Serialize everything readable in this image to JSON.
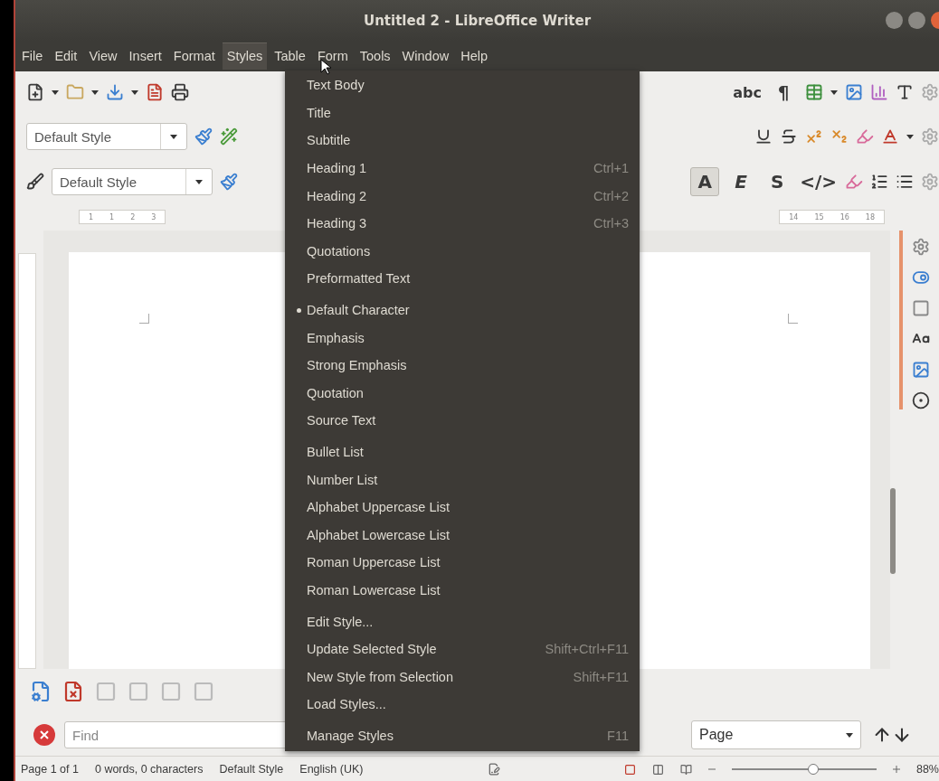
{
  "window": {
    "title": "Untitled 2 - LibreOffice Writer"
  },
  "menu_bar": [
    {
      "label": "File",
      "selected": false
    },
    {
      "label": "Edit",
      "selected": false
    },
    {
      "label": "View",
      "selected": false
    },
    {
      "label": "Insert",
      "selected": false
    },
    {
      "label": "Format",
      "selected": false
    },
    {
      "label": "Styles",
      "selected": true
    },
    {
      "label": "Table",
      "selected": false
    },
    {
      "label": "Form",
      "selected": false
    },
    {
      "label": "Tools",
      "selected": false
    },
    {
      "label": "Window",
      "selected": false
    },
    {
      "label": "Help",
      "selected": false
    }
  ],
  "standard_toolbar": {
    "spelling": "abc",
    "formatting_marks": "¶"
  },
  "formatting_toolbar": {
    "paragraph_style": "Default Style"
  },
  "character_toolbar": {
    "character_style": "Default Style",
    "buttons": [
      {
        "label": "A",
        "selected": true
      },
      {
        "label": "E",
        "selected": false
      },
      {
        "label": "S",
        "selected": false
      },
      {
        "label": "</>",
        "selected": false
      }
    ]
  },
  "ruler": {
    "left_labels": [
      "1",
      "1",
      "2",
      "3"
    ],
    "right_labels": [
      "14",
      "15",
      "16",
      "18"
    ]
  },
  "styles_menu": {
    "groups": [
      {
        "items": [
          {
            "label": "Text Body",
            "checked": false
          },
          {
            "label": "Title",
            "checked": false
          },
          {
            "label": "Subtitle",
            "checked": false
          },
          {
            "label": "Heading 1",
            "shortcut": "Ctrl+1",
            "checked": false
          },
          {
            "label": "Heading 2",
            "shortcut": "Ctrl+2",
            "checked": false
          },
          {
            "label": "Heading 3",
            "shortcut": "Ctrl+3",
            "checked": false
          },
          {
            "label": "Quotations",
            "checked": false
          },
          {
            "label": "Preformatted Text",
            "checked": false
          }
        ]
      },
      {
        "items": [
          {
            "label": "Default Character",
            "checked": true
          },
          {
            "label": "Emphasis",
            "checked": false
          },
          {
            "label": "Strong Emphasis",
            "checked": false
          },
          {
            "label": "Quotation",
            "checked": false
          },
          {
            "label": "Source Text",
            "checked": false
          }
        ]
      },
      {
        "items": [
          {
            "label": "Bullet List",
            "checked": false
          },
          {
            "label": "Number List",
            "checked": false
          },
          {
            "label": "Alphabet Uppercase List",
            "checked": false
          },
          {
            "label": "Alphabet Lowercase List",
            "checked": false
          },
          {
            "label": "Roman Uppercase List",
            "checked": false
          },
          {
            "label": "Roman Lowercase List",
            "checked": false
          }
        ]
      },
      {
        "items": [
          {
            "label": "Edit Style...",
            "checked": false
          },
          {
            "label": "Update Selected Style",
            "shortcut": "Shift+Ctrl+F11",
            "checked": false
          },
          {
            "label": "New Style from Selection",
            "shortcut": "Shift+F11",
            "checked": false
          },
          {
            "label": "Load Styles...",
            "checked": false
          }
        ]
      },
      {
        "items": [
          {
            "label": "Manage Styles",
            "shortcut": "F11",
            "checked": false
          }
        ]
      }
    ]
  },
  "find_bar": {
    "placeholder": "Find",
    "navigate_by": "Page"
  },
  "status_bar": {
    "page": "Page 1 of 1",
    "words": "0 words, 0 characters",
    "page_style": "Default Style",
    "language": "English (UK)",
    "zoom": "88%",
    "zoom_slider": {
      "level": 0.56
    }
  }
}
